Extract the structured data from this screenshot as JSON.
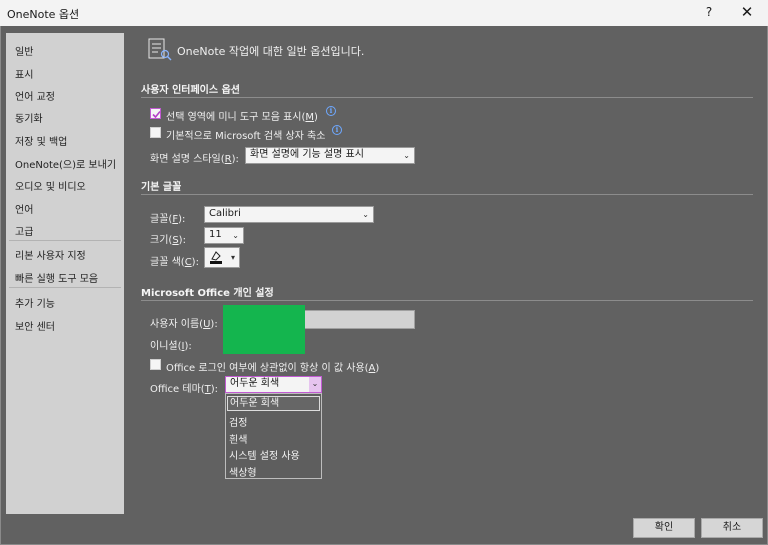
{
  "window": {
    "title": "OneNote 옵션",
    "help_label": "?",
    "close_label": "✕"
  },
  "sidebar": {
    "items": [
      {
        "label": "일반"
      },
      {
        "label": "표시"
      },
      {
        "label": "언어 교정"
      },
      {
        "label": "동기화"
      },
      {
        "label": "저장 및 백업"
      },
      {
        "label": "OneNote(으)로 보내기"
      },
      {
        "label": "오디오 및 비디오"
      },
      {
        "label": "언어"
      },
      {
        "label": "고급"
      },
      {
        "label": "리본 사용자 지정"
      },
      {
        "label": "빠른 실행 도구 모음"
      },
      {
        "label": "추가 기능"
      },
      {
        "label": "보안 센터"
      }
    ]
  },
  "main": {
    "intro": "OneNote 작업에 대한 일반 옵션입니다.",
    "ui_options": {
      "heading": "사용자 인터페이스 옵션",
      "mini_toolbar": {
        "label_pre": "선택 영역에 미니 도구 모음 표시(",
        "accel": "M",
        "label_post": ")",
        "checked": true
      },
      "collapse_search": {
        "label": "기본적으로 Microsoft 검색 상자 축소",
        "checked": false
      },
      "screentip": {
        "label_pre": "화면 설명 스타일(",
        "accel": "R",
        "label_post": "):",
        "value": "화면 설명에 기능 설명 표시"
      }
    },
    "default_font": {
      "heading": "기본 글꼴",
      "font": {
        "label_pre": "글꼴(",
        "accel": "F",
        "label_post": "):",
        "value": "Calibri"
      },
      "size": {
        "label_pre": "크기(",
        "accel": "S",
        "label_post": "):",
        "value": "11"
      },
      "color": {
        "label_pre": "글꼴 색(",
        "accel": "C",
        "label_post": "):"
      }
    },
    "personalize": {
      "heading": "Microsoft Office 개인 설정",
      "username": {
        "label_pre": "사용자 이름(",
        "accel": "U",
        "label_post": "):"
      },
      "initials": {
        "label_pre": "이니셜(",
        "accel": "I",
        "label_post": "):"
      },
      "always_use": {
        "label_pre": "Office 로그인 여부에 상관없이 항상 이 값 사용(",
        "accel": "A",
        "label_post": ")",
        "checked": false
      },
      "theme": {
        "label_pre": "Office 테마(",
        "accel": "T",
        "label_post": "):",
        "value": "어두운 회색",
        "options": [
          "어두운 회색",
          "검정",
          "흰색",
          "시스템 설정 사용",
          "색상형"
        ]
      }
    }
  },
  "footer": {
    "ok": "확인",
    "cancel": "취소"
  },
  "colors": {
    "accent": "#c15ad2",
    "green_mask": "#14b54e",
    "background": "#616161"
  }
}
